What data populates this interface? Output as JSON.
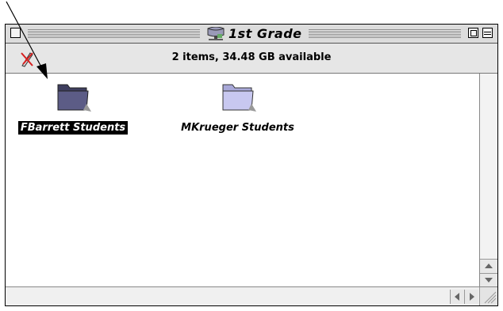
{
  "window": {
    "title": "1st Grade",
    "title_icon": "server-volume-icon",
    "info_text": "2 items, 34.48 GB available"
  },
  "items": [
    {
      "label": "FBarrett Students",
      "icon": "folder-icon",
      "selected": true
    },
    {
      "label": "MKrueger Students",
      "icon": "folder-icon",
      "selected": false
    }
  ],
  "colors": {
    "folder_selected": "#5c5c86",
    "folder_normal": "#c8c8f0",
    "selection_bg": "#000000"
  }
}
